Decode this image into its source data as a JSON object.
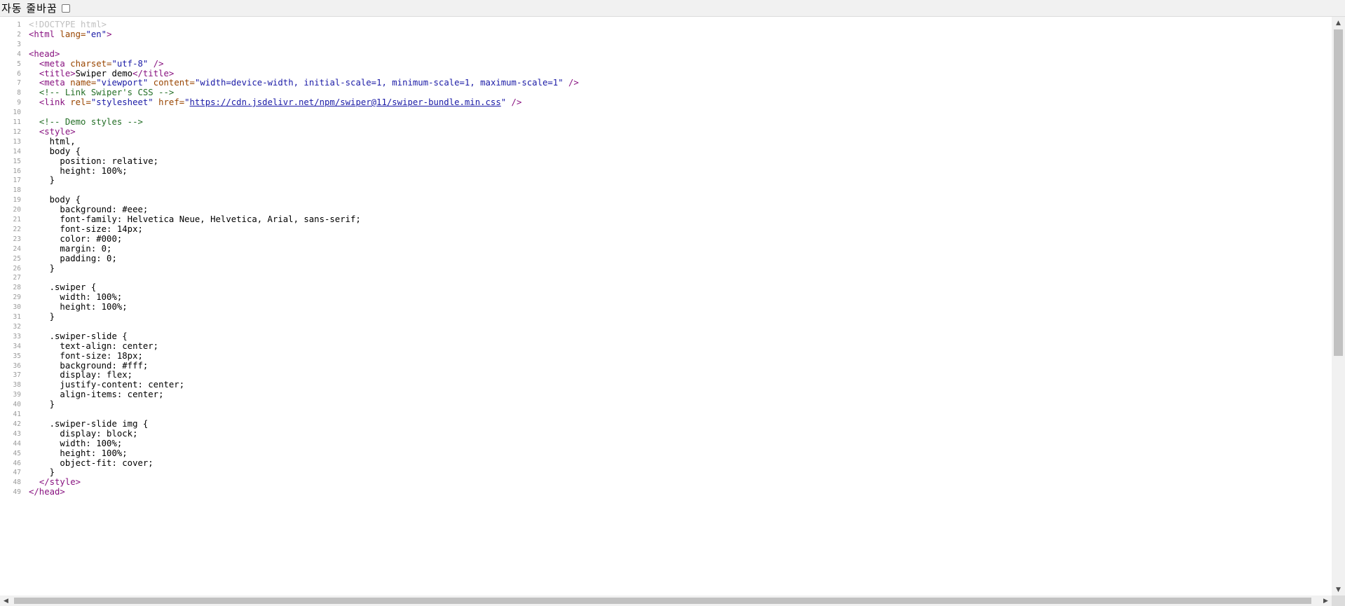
{
  "toolbar": {
    "wrap_label": "자동 줄바꿈",
    "wrap_checked": false
  },
  "source_lines": [
    {
      "n": "1",
      "parts": [
        {
          "c": "doctype",
          "t": "<!DOCTYPE html>"
        }
      ]
    },
    {
      "n": "2",
      "parts": [
        {
          "c": "tag",
          "t": "<html "
        },
        {
          "c": "attr",
          "t": "lang="
        },
        {
          "c": "val",
          "t": "\"en\""
        },
        {
          "c": "tag",
          "t": ">"
        }
      ]
    },
    {
      "n": "3",
      "parts": []
    },
    {
      "n": "4",
      "parts": [
        {
          "c": "tag",
          "t": "<head>"
        }
      ]
    },
    {
      "n": "5",
      "parts": [
        {
          "c": "text",
          "t": "  "
        },
        {
          "c": "tag",
          "t": "<meta "
        },
        {
          "c": "attr",
          "t": "charset="
        },
        {
          "c": "val",
          "t": "\"utf-8\""
        },
        {
          "c": "tag",
          "t": " />"
        }
      ]
    },
    {
      "n": "6",
      "parts": [
        {
          "c": "text",
          "t": "  "
        },
        {
          "c": "tag",
          "t": "<title>"
        },
        {
          "c": "text",
          "t": "Swiper demo"
        },
        {
          "c": "tag",
          "t": "</title>"
        }
      ]
    },
    {
      "n": "7",
      "parts": [
        {
          "c": "text",
          "t": "  "
        },
        {
          "c": "tag",
          "t": "<meta "
        },
        {
          "c": "attr",
          "t": "name="
        },
        {
          "c": "val",
          "t": "\"viewport\""
        },
        {
          "c": "attr",
          "t": " content="
        },
        {
          "c": "val",
          "t": "\"width=device-width, initial-scale=1, minimum-scale=1, maximum-scale=1\""
        },
        {
          "c": "tag",
          "t": " />"
        }
      ]
    },
    {
      "n": "8",
      "parts": [
        {
          "c": "text",
          "t": "  "
        },
        {
          "c": "comment",
          "t": "<!-- Link Swiper's CSS -->"
        }
      ]
    },
    {
      "n": "9",
      "parts": [
        {
          "c": "text",
          "t": "  "
        },
        {
          "c": "tag",
          "t": "<link "
        },
        {
          "c": "attr",
          "t": "rel="
        },
        {
          "c": "val",
          "t": "\"stylesheet\""
        },
        {
          "c": "attr",
          "t": " href="
        },
        {
          "c": "val",
          "t": "\""
        },
        {
          "c": "link",
          "t": "https://cdn.jsdelivr.net/npm/swiper@11/swiper-bundle.min.css"
        },
        {
          "c": "val",
          "t": "\""
        },
        {
          "c": "tag",
          "t": " />"
        }
      ]
    },
    {
      "n": "10",
      "parts": []
    },
    {
      "n": "11",
      "parts": [
        {
          "c": "text",
          "t": "  "
        },
        {
          "c": "comment",
          "t": "<!-- Demo styles -->"
        }
      ]
    },
    {
      "n": "12",
      "parts": [
        {
          "c": "text",
          "t": "  "
        },
        {
          "c": "tag",
          "t": "<style>"
        }
      ]
    },
    {
      "n": "13",
      "parts": [
        {
          "c": "text",
          "t": "    html,"
        }
      ]
    },
    {
      "n": "14",
      "parts": [
        {
          "c": "text",
          "t": "    body {"
        }
      ]
    },
    {
      "n": "15",
      "parts": [
        {
          "c": "text",
          "t": "      position: relative;"
        }
      ]
    },
    {
      "n": "16",
      "parts": [
        {
          "c": "text",
          "t": "      height: 100%;"
        }
      ]
    },
    {
      "n": "17",
      "parts": [
        {
          "c": "text",
          "t": "    }"
        }
      ]
    },
    {
      "n": "18",
      "parts": []
    },
    {
      "n": "19",
      "parts": [
        {
          "c": "text",
          "t": "    body {"
        }
      ]
    },
    {
      "n": "20",
      "parts": [
        {
          "c": "text",
          "t": "      background: #eee;"
        }
      ]
    },
    {
      "n": "21",
      "parts": [
        {
          "c": "text",
          "t": "      font-family: Helvetica Neue, Helvetica, Arial, sans-serif;"
        }
      ]
    },
    {
      "n": "22",
      "parts": [
        {
          "c": "text",
          "t": "      font-size: 14px;"
        }
      ]
    },
    {
      "n": "23",
      "parts": [
        {
          "c": "text",
          "t": "      color: #000;"
        }
      ]
    },
    {
      "n": "24",
      "parts": [
        {
          "c": "text",
          "t": "      margin: 0;"
        }
      ]
    },
    {
      "n": "25",
      "parts": [
        {
          "c": "text",
          "t": "      padding: 0;"
        }
      ]
    },
    {
      "n": "26",
      "parts": [
        {
          "c": "text",
          "t": "    }"
        }
      ]
    },
    {
      "n": "27",
      "parts": []
    },
    {
      "n": "28",
      "parts": [
        {
          "c": "text",
          "t": "    .swiper {"
        }
      ]
    },
    {
      "n": "29",
      "parts": [
        {
          "c": "text",
          "t": "      width: 100%;"
        }
      ]
    },
    {
      "n": "30",
      "parts": [
        {
          "c": "text",
          "t": "      height: 100%;"
        }
      ]
    },
    {
      "n": "31",
      "parts": [
        {
          "c": "text",
          "t": "    }"
        }
      ]
    },
    {
      "n": "32",
      "parts": []
    },
    {
      "n": "33",
      "parts": [
        {
          "c": "text",
          "t": "    .swiper-slide {"
        }
      ]
    },
    {
      "n": "34",
      "parts": [
        {
          "c": "text",
          "t": "      text-align: center;"
        }
      ]
    },
    {
      "n": "35",
      "parts": [
        {
          "c": "text",
          "t": "      font-size: 18px;"
        }
      ]
    },
    {
      "n": "36",
      "parts": [
        {
          "c": "text",
          "t": "      background: #fff;"
        }
      ]
    },
    {
      "n": "37",
      "parts": [
        {
          "c": "text",
          "t": "      display: flex;"
        }
      ]
    },
    {
      "n": "38",
      "parts": [
        {
          "c": "text",
          "t": "      justify-content: center;"
        }
      ]
    },
    {
      "n": "39",
      "parts": [
        {
          "c": "text",
          "t": "      align-items: center;"
        }
      ]
    },
    {
      "n": "40",
      "parts": [
        {
          "c": "text",
          "t": "    }"
        }
      ]
    },
    {
      "n": "41",
      "parts": []
    },
    {
      "n": "42",
      "parts": [
        {
          "c": "text",
          "t": "    .swiper-slide img {"
        }
      ]
    },
    {
      "n": "43",
      "parts": [
        {
          "c": "text",
          "t": "      display: block;"
        }
      ]
    },
    {
      "n": "44",
      "parts": [
        {
          "c": "text",
          "t": "      width: 100%;"
        }
      ]
    },
    {
      "n": "45",
      "parts": [
        {
          "c": "text",
          "t": "      height: 100%;"
        }
      ]
    },
    {
      "n": "46",
      "parts": [
        {
          "c": "text",
          "t": "      object-fit: cover;"
        }
      ]
    },
    {
      "n": "47",
      "parts": [
        {
          "c": "text",
          "t": "    }"
        }
      ]
    },
    {
      "n": "48",
      "parts": [
        {
          "c": "text",
          "t": "  "
        },
        {
          "c": "tag",
          "t": "</style>"
        }
      ]
    },
    {
      "n": "49",
      "parts": [
        {
          "c": "tag",
          "t": "</head>"
        }
      ]
    }
  ],
  "icons": {
    "scroll_up": "▲",
    "scroll_down": "▼",
    "scroll_left": "◀",
    "scroll_right": "▶"
  }
}
